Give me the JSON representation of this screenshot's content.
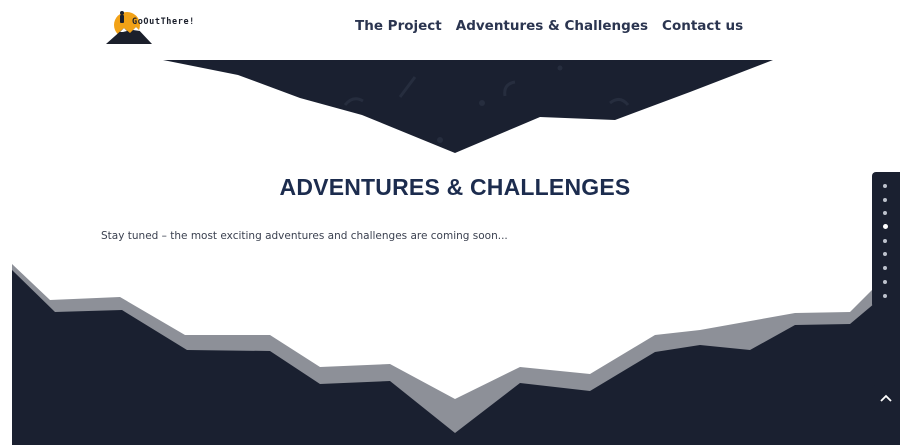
{
  "header": {
    "logo_text": "GoOutThere!",
    "nav": [
      {
        "label": "The Project"
      },
      {
        "label": "Adventures & Challenges"
      },
      {
        "label": "Contact us"
      }
    ]
  },
  "section": {
    "title": "ADVENTURES & CHALLENGES",
    "text": "Stay tuned – the most exciting adventures and  challenges are coming soon..."
  },
  "dot_navigation": {
    "count": 9,
    "active_index": 3
  },
  "icons": {
    "logo": "mountain-sun-logo-icon",
    "back_to_top": "chevron-up-icon"
  },
  "colors": {
    "navy": "#1a2030",
    "slate": "#8d9098",
    "title": "#1c2c4e",
    "logo_sun": "#f2a217"
  }
}
